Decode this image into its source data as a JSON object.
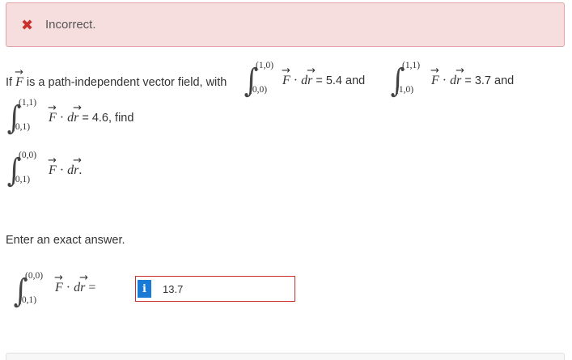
{
  "feedback": {
    "icon": "close-icon",
    "message": "Incorrect.",
    "color": "#c9302c"
  },
  "question": {
    "intro": "If",
    "field_symbol": "F",
    "mid_text": "is a path-independent vector field, with",
    "integral1": {
      "upper": "(1,0)",
      "lower": "(0,0)",
      "value": "= 5.4 and"
    },
    "integral2": {
      "upper": "(1,1)",
      "lower": "(1,0)",
      "value": "= 3.7 and"
    },
    "integral3": {
      "upper": "(1,1)",
      "lower": "(0,1)",
      "value": "= 4.6, find"
    },
    "integral4": {
      "upper": "(0,0)",
      "lower": "(0,1)",
      "value": "."
    },
    "integrand_F": "F",
    "integrand_dot": "·",
    "integrand_d": "d",
    "integrand_r": "r"
  },
  "instruction": "Enter an exact answer.",
  "answer": {
    "upper": "(0,0)",
    "lower": "(0,1)",
    "equals": "=",
    "info_icon": "i",
    "value": "13.7"
  }
}
